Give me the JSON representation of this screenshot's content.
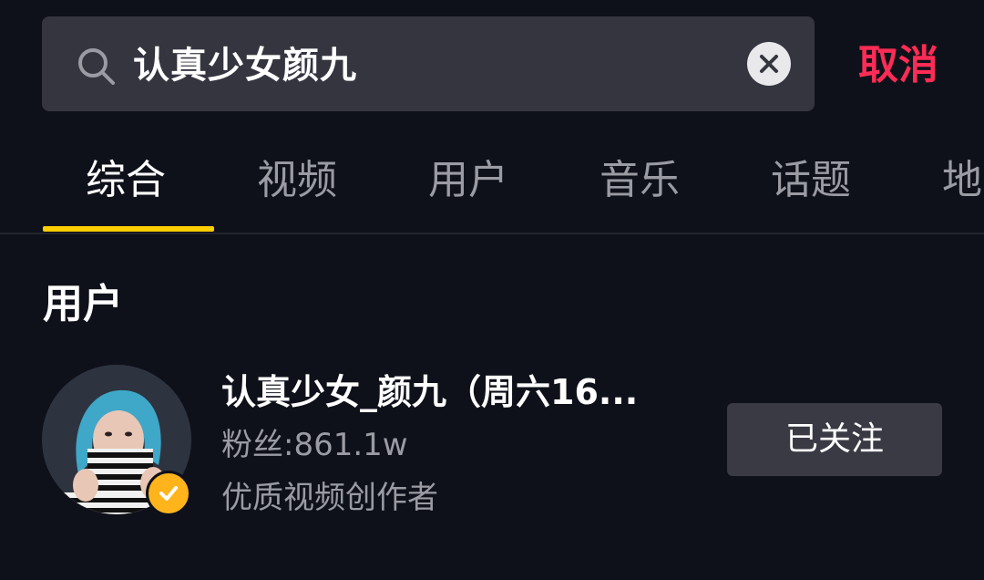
{
  "search": {
    "query": "认真少女颜九",
    "cancel_label": "取消"
  },
  "tabs": [
    {
      "label": "综合",
      "active": true
    },
    {
      "label": "视频"
    },
    {
      "label": "用户"
    },
    {
      "label": "音乐"
    },
    {
      "label": "话题"
    },
    {
      "label": "地"
    }
  ],
  "colors": {
    "accent": "#fb2c55",
    "tab_indicator": "#fdce00",
    "verified": "#ffb41c",
    "background": "#0f111a"
  },
  "users_section": {
    "title": "用户",
    "results": [
      {
        "name": "认真少女_颜九（周六16...",
        "fans": "粉丝:861.1w",
        "description": "优质视频创作者",
        "follow_label": "已关注",
        "verified": true
      }
    ]
  }
}
